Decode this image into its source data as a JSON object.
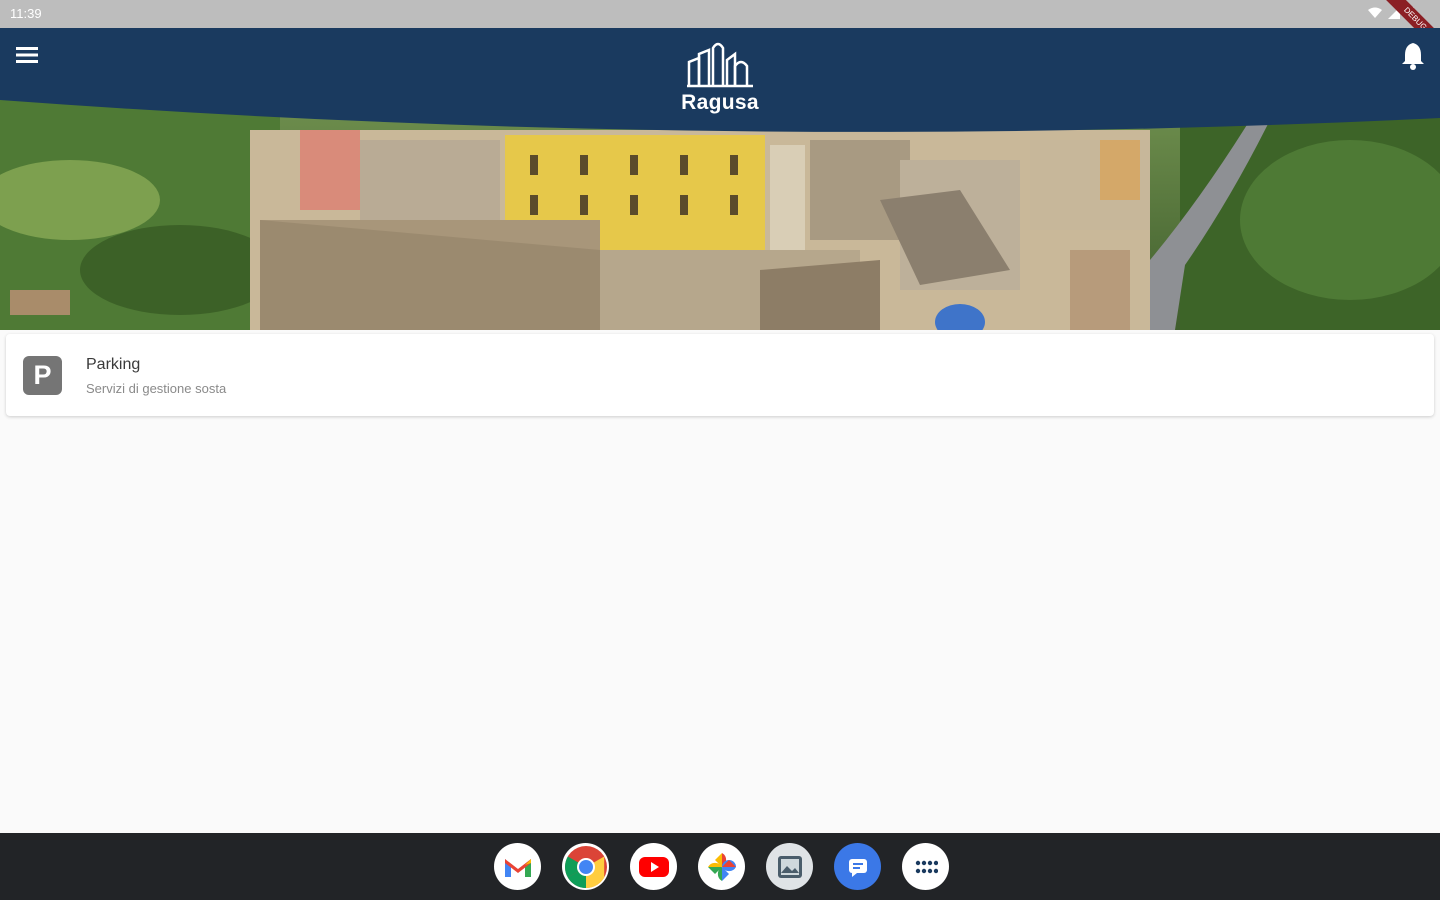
{
  "status_bar": {
    "time": "11:39",
    "debug_banner": "DEBUG",
    "icons": [
      "wifi-icon",
      "signal-icon",
      "battery-icon"
    ]
  },
  "app_bar": {
    "logo_text": "Ragusa",
    "menu_icon": "menu-icon",
    "notification_icon": "bell-icon",
    "color": "#1a3a5f"
  },
  "cards": [
    {
      "title": "Parking",
      "subtitle": "Servizi di gestione sosta",
      "icon": "parking-icon",
      "icon_letter": "P"
    }
  ],
  "taskbar": {
    "apps": [
      "Gmail",
      "Chrome",
      "YouTube",
      "Photos",
      "Gallery",
      "Messages",
      "App drawer"
    ]
  }
}
